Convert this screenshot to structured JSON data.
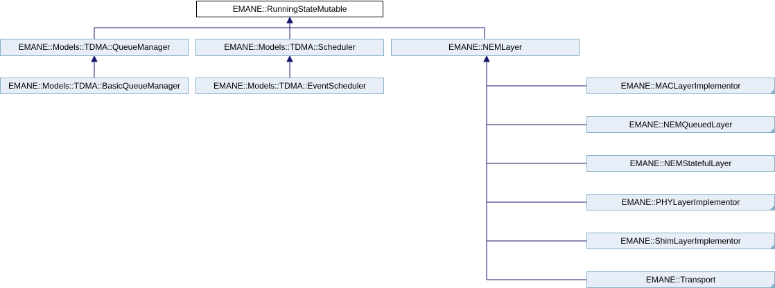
{
  "colors": {
    "edge": "#191970",
    "box_border": "#84b0c7",
    "box_fill": "#e8eef7",
    "root_border": "#000000",
    "root_fill": "#ffffff",
    "corner_mark": "#84b0c7"
  },
  "nodes": {
    "root": {
      "label": "EMANE::RunningStateMutable"
    },
    "queue_manager": {
      "label": "EMANE::Models::TDMA::QueueManager"
    },
    "scheduler": {
      "label": "EMANE::Models::TDMA::Scheduler"
    },
    "nem_layer": {
      "label": "EMANE::NEMLayer"
    },
    "basic_queue_manager": {
      "label": "EMANE::Models::TDMA::BasicQueueManager"
    },
    "event_scheduler": {
      "label": "EMANE::Models::TDMA::EventScheduler"
    },
    "mac_layer_implementor": {
      "label": "EMANE::MACLayerImplementor",
      "has_more": true
    },
    "nem_queued_layer": {
      "label": "EMANE::NEMQueuedLayer",
      "has_more": true
    },
    "nem_stateful_layer": {
      "label": "EMANE::NEMStatefulLayer",
      "has_more": false
    },
    "phy_layer_implementor": {
      "label": "EMANE::PHYLayerImplementor",
      "has_more": true
    },
    "shim_layer_implementor": {
      "label": "EMANE::ShimLayerImplementor",
      "has_more": true
    },
    "transport": {
      "label": "EMANE::Transport",
      "has_more": true
    }
  },
  "edges": [
    {
      "from": "queue_manager",
      "to": "root"
    },
    {
      "from": "scheduler",
      "to": "root"
    },
    {
      "from": "nem_layer",
      "to": "root"
    },
    {
      "from": "basic_queue_manager",
      "to": "queue_manager"
    },
    {
      "from": "event_scheduler",
      "to": "scheduler"
    },
    {
      "from": "mac_layer_implementor",
      "to": "nem_layer"
    },
    {
      "from": "nem_queued_layer",
      "to": "nem_layer"
    },
    {
      "from": "nem_stateful_layer",
      "to": "nem_layer"
    },
    {
      "from": "phy_layer_implementor",
      "to": "nem_layer"
    },
    {
      "from": "shim_layer_implementor",
      "to": "nem_layer"
    },
    {
      "from": "transport",
      "to": "nem_layer"
    }
  ]
}
